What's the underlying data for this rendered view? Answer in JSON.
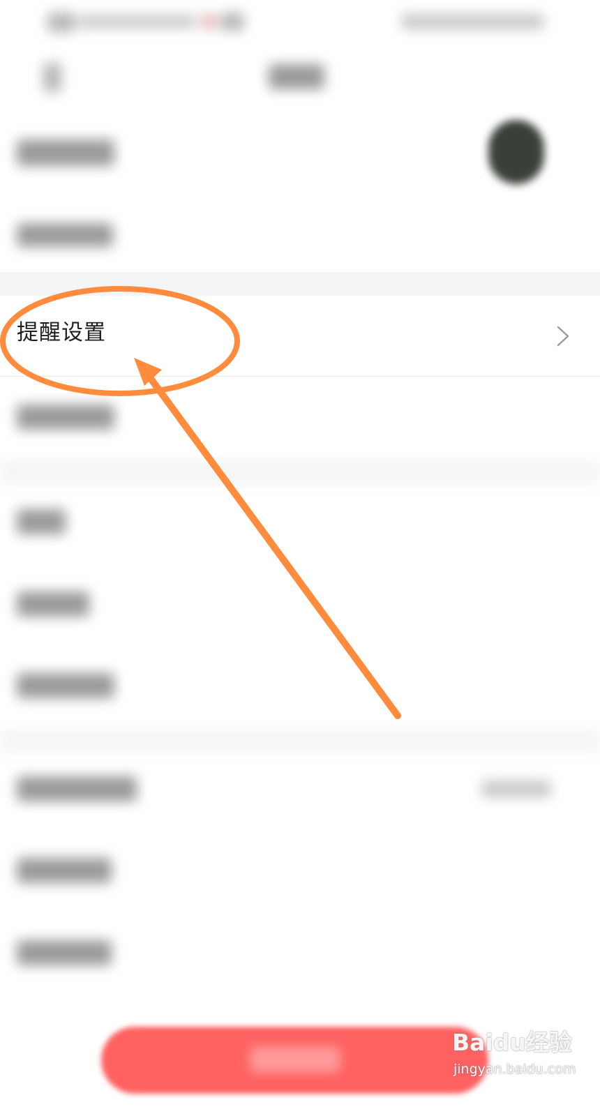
{
  "settings_list": {
    "highlighted_item": {
      "label": "提醒设置",
      "chevron_icon": "chevron-right-icon"
    }
  },
  "watermark": {
    "brand": "Baidu经验",
    "url": "jingyan.baidu.com"
  },
  "annotation": {
    "color": "#ff8c3c"
  }
}
